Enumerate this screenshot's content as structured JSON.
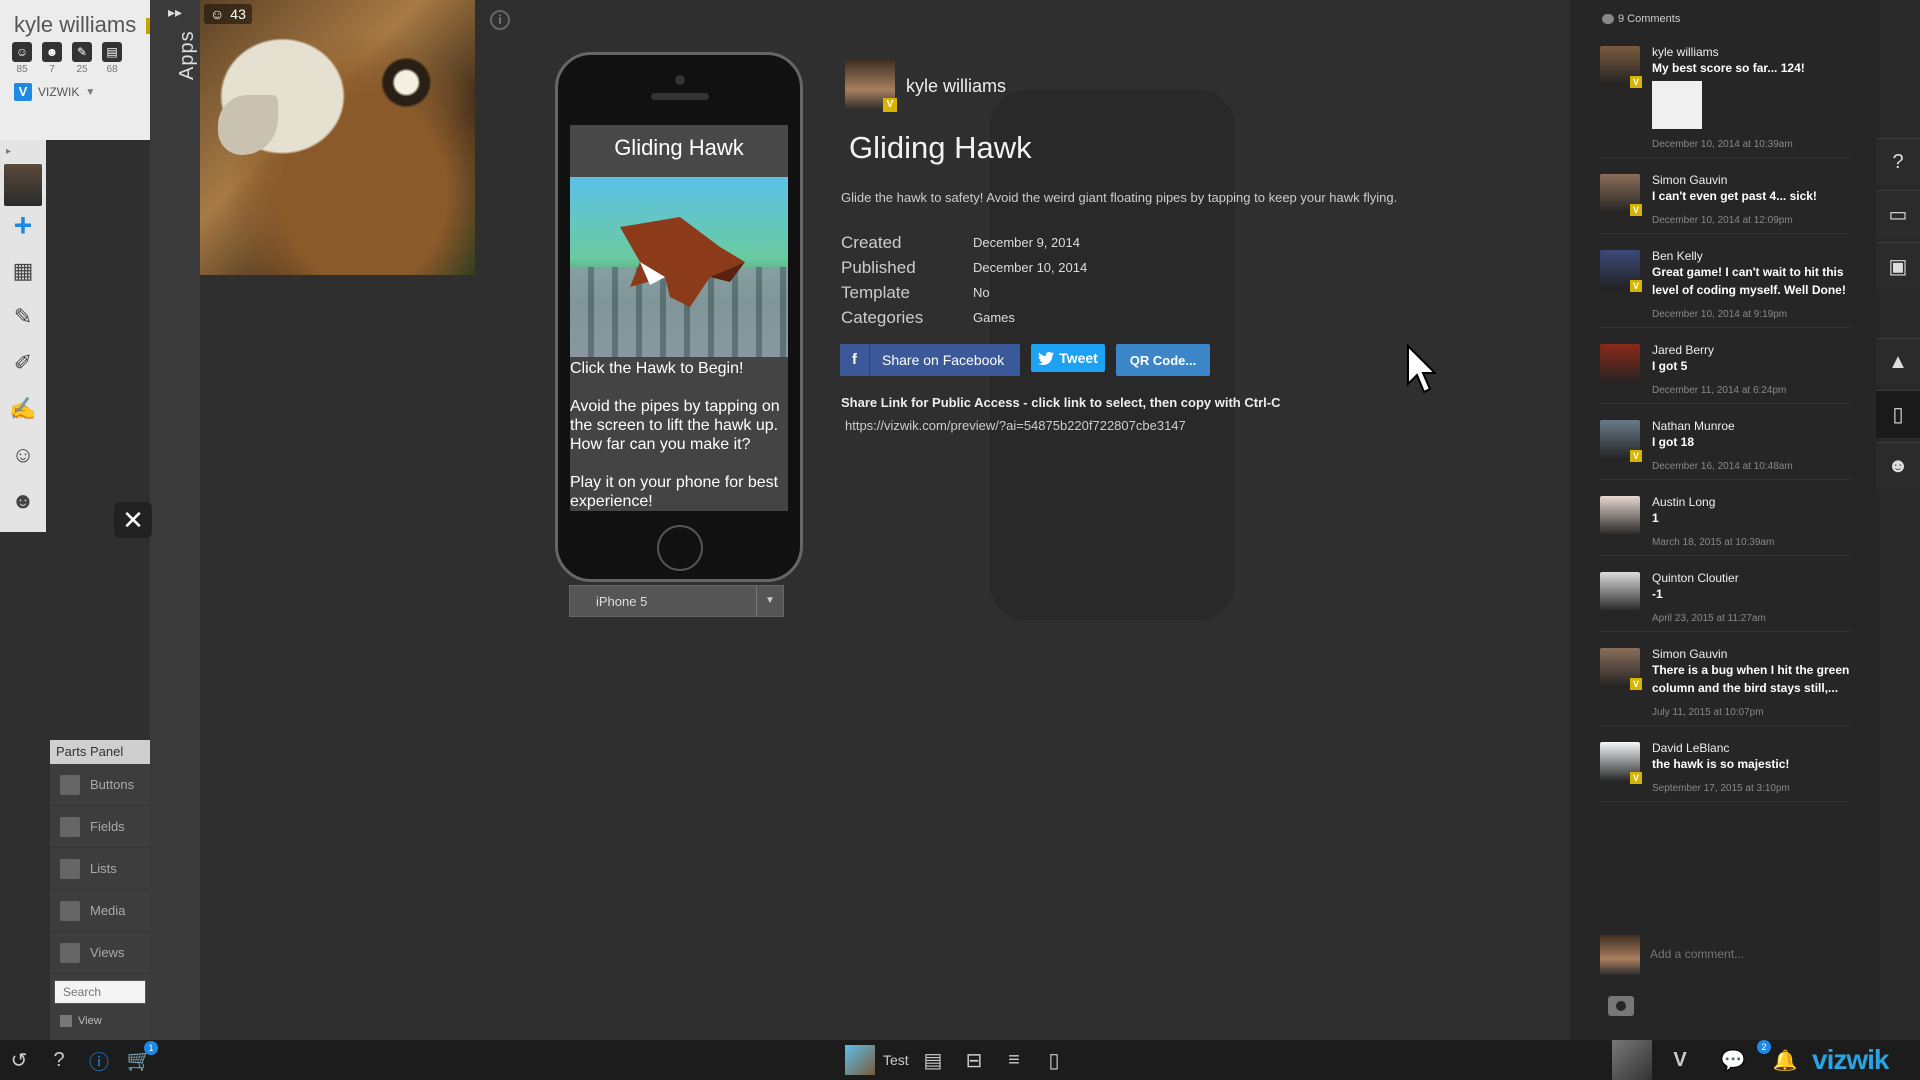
{
  "user": {
    "name": "kyle williams",
    "stats": [
      {
        "icon": "apps-icon",
        "glyph": "☺",
        "value": "85"
      },
      {
        "icon": "likes-icon",
        "glyph": "☻",
        "value": "7"
      },
      {
        "icon": "edit-icon",
        "glyph": "✎",
        "value": "25"
      },
      {
        "icon": "doc-icon",
        "glyph": "▤",
        "value": "68"
      }
    ],
    "org": {
      "badge": "V",
      "name": "VIZWIK"
    }
  },
  "apps_label": "Apps",
  "app_likes": "43",
  "phone": {
    "game_title": "Gliding Hawk",
    "game_text": "Click the Hawk to Begin!\n\nAvoid the pipes by tapping on the screen to lift the hawk up. How far can you make it?\n\nPlay it on your phone for best experience!",
    "device": "iPhone 5"
  },
  "details": {
    "author": "kyle williams",
    "title": "Gliding Hawk",
    "description": "Glide the hawk to safety! Avoid the weird giant floating pipes by tapping to keep your hawk flying.",
    "meta": [
      {
        "key": "Created",
        "value": "December 9, 2014"
      },
      {
        "key": "Published",
        "value": "December 10, 2014"
      },
      {
        "key": "Template",
        "value": "No"
      },
      {
        "key": "Categories",
        "value": "Games"
      }
    ],
    "buttons": {
      "facebook_icon": "f",
      "facebook": "Share on Facebook",
      "tweet": "Tweet",
      "qr": "QR Code..."
    },
    "share_label": "Share Link for Public Access - click link to select, then copy with Ctrl-C",
    "share_link": "https://vizwik.com/preview/?ai=54875b220f722807cbe3147e"
  },
  "comments": {
    "count_label": "9 Comments",
    "items": [
      {
        "name": "kyle williams",
        "text": "My best score so far... 124!",
        "time": "December 10, 2014 at 10:39am",
        "avatar": "#7a5a3e",
        "verified": true,
        "thumb": true
      },
      {
        "name": "Simon Gauvin",
        "text": "I can't even get past 4... sick!",
        "time": "December 10, 2014 at 12:09pm",
        "avatar": "#8a6e5a",
        "verified": true,
        "thumb": false
      },
      {
        "name": "Ben Kelly",
        "text": "Great game! I can't wait to hit this level of coding myself. Well Done!",
        "time": "December 10, 2014 at 9:19pm",
        "avatar": "#3a4a7a",
        "verified": true,
        "thumb": false
      },
      {
        "name": "Jared Berry",
        "text": "I got 5",
        "time": "December 11, 2014 at 6:24pm",
        "avatar": "#8a2a1a",
        "verified": false,
        "thumb": false
      },
      {
        "name": "Nathan Munroe",
        "text": "I got 18",
        "time": "December 16, 2014 at 10:48am",
        "avatar": "#6a7a8a",
        "verified": true,
        "thumb": false
      },
      {
        "name": "Austin Long",
        "text": "1",
        "time": "March 18, 2015 at 10:39am",
        "avatar": "#e8d8d0",
        "verified": false,
        "thumb": false
      },
      {
        "name": "Quinton Cloutier",
        "text": "-1",
        "time": "April 23, 2015 at 11:27am",
        "avatar": "#dddddd",
        "verified": false,
        "thumb": false
      },
      {
        "name": "Simon Gauvin",
        "text": "There is a bug when I hit the green column and the bird stays still,...",
        "time": "July 11, 2015 at 10:07pm",
        "avatar": "#8a6e5a",
        "verified": true,
        "thumb": false
      },
      {
        "name": "David LeBlanc",
        "text": "the hawk is so majestic!",
        "time": "September 17, 2015 at 3:10pm",
        "avatar": "#f4f8fb",
        "verified": true,
        "thumb": false
      }
    ],
    "add_placeholder": "Add a comment..."
  },
  "parts_panel": {
    "title": "Parts Panel",
    "items": [
      "Buttons",
      "Fields",
      "Lists",
      "Media",
      "Views"
    ],
    "search_placeholder": "Search",
    "view_label": "View"
  },
  "bottom_bar": {
    "test_label": "Test",
    "cart_count": "1",
    "messages_count": "2",
    "brand": "vizwik",
    "brand_v": "V"
  }
}
